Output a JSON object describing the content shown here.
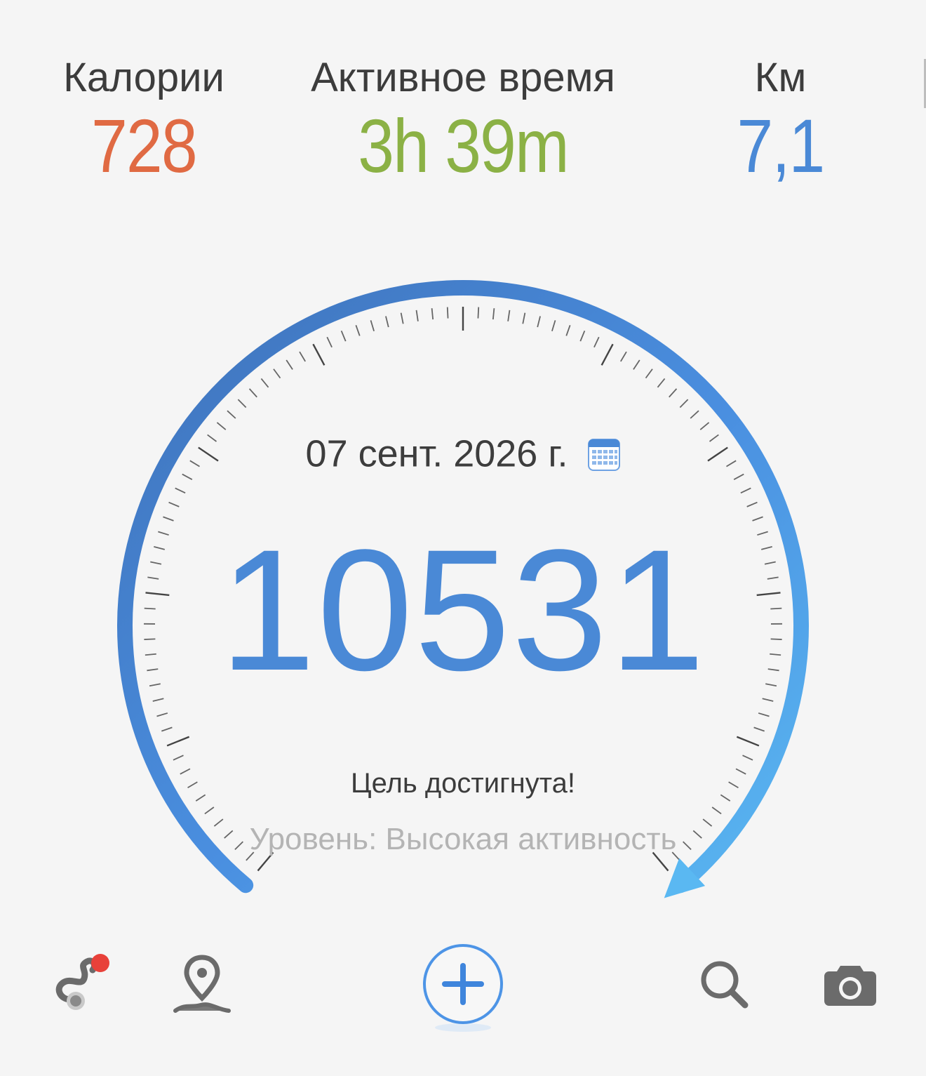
{
  "stats": {
    "calories": {
      "label": "Калории",
      "value": "728",
      "color": "#e06a43"
    },
    "active_time": {
      "label": "Активное время",
      "value": "3h 39m",
      "color": "#8bb145"
    },
    "distance": {
      "label": "Км",
      "value": "7,1",
      "color": "#4a89d6"
    }
  },
  "dial": {
    "date": "07 сент. 2026 г.",
    "steps": "10531",
    "goal_status": "Цель достигнута!",
    "activity_level": "Уровень: Высокая активность",
    "progress_fraction": 1.0,
    "arc_color_start": "#3f72ba",
    "arc_color_end": "#5ab8f2"
  },
  "icons": {
    "calendar": "calendar-icon",
    "route": "route-icon",
    "map": "map-pin-icon",
    "add": "plus-icon",
    "search": "search-icon",
    "camera": "camera-icon"
  },
  "notification_dot_color": "#e8413a"
}
